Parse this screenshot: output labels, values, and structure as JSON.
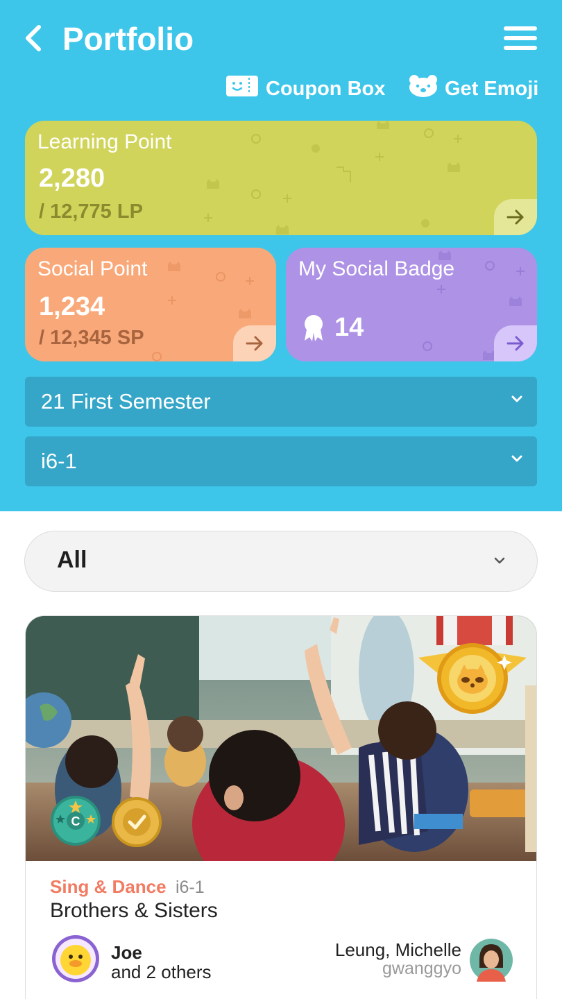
{
  "header": {
    "title": "Portfolio",
    "back_icon": "chevron-left-icon",
    "menu_icon": "hamburger-menu-icon",
    "coupon_label": "Coupon Box",
    "coupon_icon": "ticket-icon",
    "emoji_label": "Get Emoji",
    "emoji_icon": "bear-face-icon"
  },
  "learning_point": {
    "label": "Learning Point",
    "value": "2,280",
    "total": "/ 12,775 LP",
    "color": "#d0d45a"
  },
  "social_point": {
    "label": "Social Point",
    "value": "1,234",
    "total": "/ 12,345 SP",
    "color": "#f9a979"
  },
  "social_badge": {
    "label": "My Social Badge",
    "count": "14",
    "icon": "ribbon-badge-icon",
    "color": "#ad92e6"
  },
  "filters": {
    "semester": "21 First Semester",
    "class": "i6-1",
    "category": "All"
  },
  "post": {
    "category": "Sing & Dance",
    "class": "i6-1",
    "title": "Brothers & Sisters",
    "author": "Joe",
    "others": "and 2 others",
    "teacher_name": "Leung, Michelle",
    "teacher_id": "gwanggyo",
    "medal_icon": "gold-medal-icon",
    "badges": [
      "creativity-badge-icon",
      "teachers-pick-badge-icon"
    ]
  },
  "colors": {
    "header_bg": "#3ec6ea",
    "dropdown_bg": "#35a6c8",
    "category_text": "#f27b62"
  }
}
